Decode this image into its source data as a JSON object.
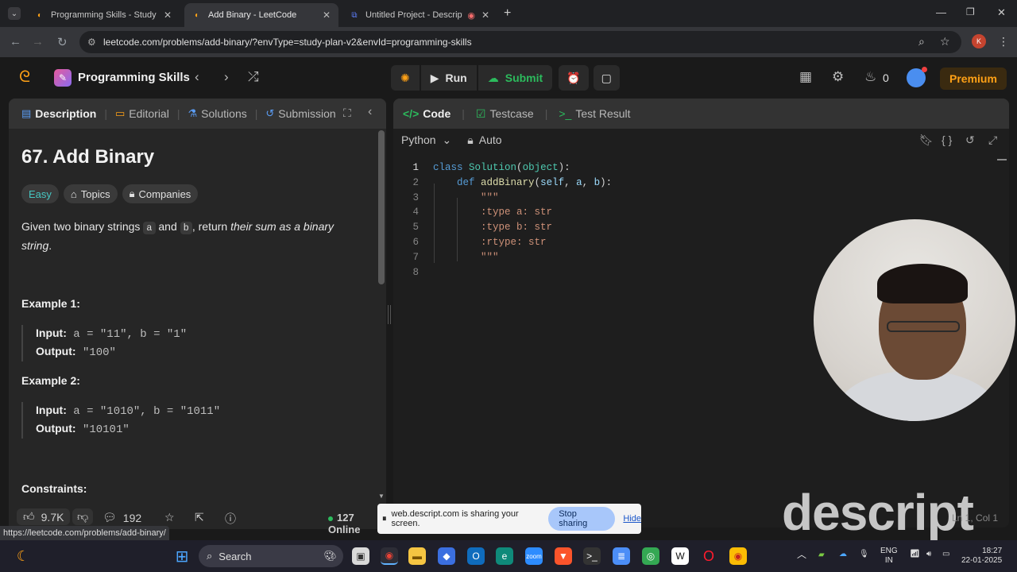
{
  "browser": {
    "tabs": [
      {
        "label": "Programming Skills - Study Plan",
        "icon": "leetcode-icon"
      },
      {
        "label": "Add Binary - LeetCode",
        "icon": "leetcode-icon"
      },
      {
        "label": "Untitled Project - Descript",
        "icon": "descript-icon"
      }
    ],
    "url": "leetcode.com/problems/add-binary/?envType=study-plan-v2&envId=programming-skills",
    "profile_initial": "K",
    "status_url": "https://leetcode.com/problems/add-binary/"
  },
  "nav": {
    "study_plan_title": "Programming Skills",
    "run_label": "Run",
    "submit_label": "Submit",
    "streak_count": "0",
    "premium_label": "Premium"
  },
  "left": {
    "tabs": [
      "Description",
      "Editorial",
      "Solutions",
      "Submission"
    ],
    "problem_title": "67. Add Binary",
    "badges": {
      "difficulty": "Easy",
      "topics": "Topics",
      "companies": "Companies"
    },
    "desc": {
      "p1": "Given two binary strings ",
      "a": "a",
      "p2": " and ",
      "b": "b",
      "p3": ", return ",
      "em": "their sum as a binary string",
      "p4": "."
    },
    "example1": {
      "heading": "Example 1:",
      "input_label": "Input:",
      "input": "a = \"11\", b = \"1\"",
      "output_label": "Output:",
      "output": "\"100\""
    },
    "example2": {
      "heading": "Example 2:",
      "input_label": "Input:",
      "input": "a = \"1010\", b = \"1011\"",
      "output_label": "Output:",
      "output": "\"10101\""
    },
    "constraints_heading": "Constraints:",
    "footer": {
      "likes": "9.7K",
      "comments": "192",
      "online": "127 Online"
    }
  },
  "right": {
    "tabs": [
      "Code",
      "Testcase",
      "Test Result"
    ],
    "language": "Python",
    "mode": "Auto",
    "code_lines": [
      {
        "n": "1",
        "text": "class Solution(object):"
      },
      {
        "n": "2",
        "text": "    def addBinary(self, a, b):"
      },
      {
        "n": "3",
        "text": "        \"\"\""
      },
      {
        "n": "4",
        "text": "        :type a: str"
      },
      {
        "n": "5",
        "text": "        :type b: str"
      },
      {
        "n": "6",
        "text": "        :rtype: str"
      },
      {
        "n": "7",
        "text": "        \"\"\""
      },
      {
        "n": "8",
        "text": ""
      }
    ],
    "cursor_pos": "Ln 1, Col 1"
  },
  "overlay": {
    "watermark": "descript",
    "share_text": "web.descript.com is sharing your screen.",
    "stop_label": "Stop sharing",
    "hide_label": "Hide"
  },
  "taskbar": {
    "search_label": "Search",
    "lang1": "ENG",
    "lang2": "IN",
    "time": "18:27",
    "date": "22-01-2025"
  },
  "colors": {
    "accent": "#ffa116",
    "submit_green": "#2cbb5d",
    "easy": "#46c6c2"
  }
}
